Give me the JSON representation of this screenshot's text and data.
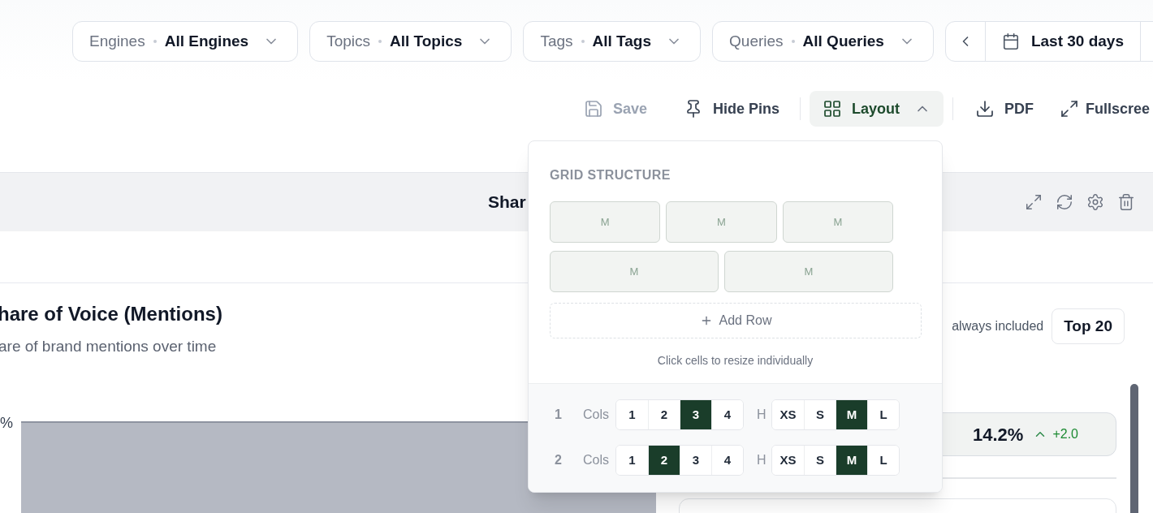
{
  "filters": [
    {
      "label": "Engines",
      "value": "All Engines"
    },
    {
      "label": "Topics",
      "value": "All Topics"
    },
    {
      "label": "Tags",
      "value": "All Tags"
    },
    {
      "label": "Queries",
      "value": "All Queries"
    }
  ],
  "date_range": {
    "value": "Last 30 days"
  },
  "toolbar": [
    {
      "kind": "save",
      "label": "Save",
      "disabled": true
    },
    {
      "kind": "pins",
      "label": "Hide Pins",
      "disabled": false
    },
    {
      "kind": "layout",
      "label": "Layout",
      "disabled": false,
      "expanded": true
    },
    {
      "kind": "pdf",
      "label": "PDF",
      "disabled": false
    },
    {
      "kind": "fullscreen",
      "label": "Fullscree",
      "disabled": false
    }
  ],
  "layout_menu": {
    "heading": "GRID STRUCTURE",
    "grid": [
      {
        "cells": [
          "M",
          "M",
          "M"
        ]
      },
      {
        "cells": [
          "M",
          "M"
        ]
      }
    ],
    "add_row": "Add Row",
    "hint": "Click cells to resize individually",
    "row_settings": [
      {
        "index": "1",
        "cols_label": "Cols",
        "cols": [
          {
            "label": "1",
            "selected": false
          },
          {
            "label": "2",
            "selected": false
          },
          {
            "label": "3",
            "selected": true
          },
          {
            "label": "4",
            "selected": false
          }
        ],
        "height_label": "H",
        "heights": [
          {
            "label": "XS",
            "selected": false
          },
          {
            "label": "S",
            "selected": false
          },
          {
            "label": "M",
            "selected": true
          },
          {
            "label": "L",
            "selected": false
          }
        ]
      },
      {
        "index": "2",
        "cols_label": "Cols",
        "cols": [
          {
            "label": "1",
            "selected": false
          },
          {
            "label": "2",
            "selected": true
          },
          {
            "label": "3",
            "selected": false
          },
          {
            "label": "4",
            "selected": false
          }
        ],
        "height_label": "H",
        "heights": [
          {
            "label": "XS",
            "selected": false
          },
          {
            "label": "S",
            "selected": false
          },
          {
            "label": "M",
            "selected": true
          },
          {
            "label": "L",
            "selected": false
          }
        ]
      }
    ]
  },
  "widget": {
    "title": "Shar",
    "chart_title": "hare of Voice (Mentions)",
    "chart_subtitle": "are of brand mentions over time",
    "y_label": "%",
    "note": "always included",
    "top_button": "Top 20",
    "metric": {
      "value": "14.2%",
      "delta": "+2.0"
    }
  }
}
